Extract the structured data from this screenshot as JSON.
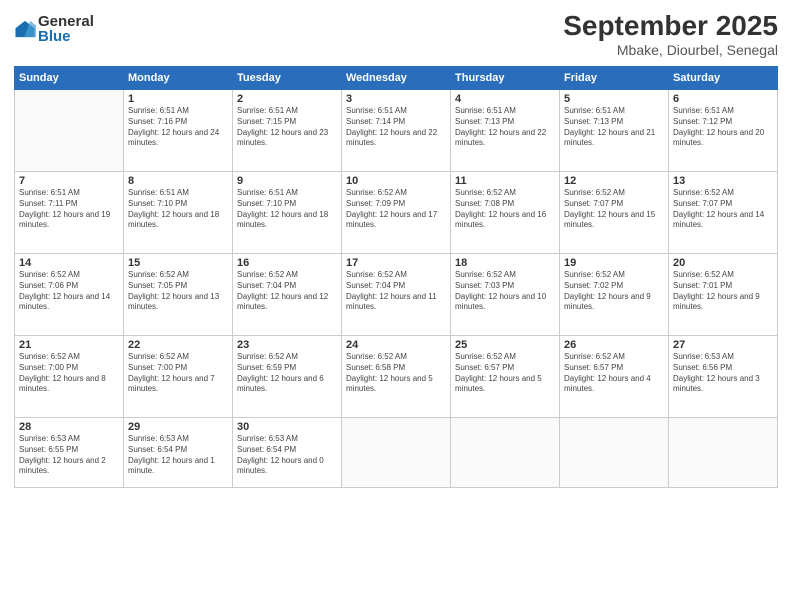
{
  "logo": {
    "general": "General",
    "blue": "Blue"
  },
  "header": {
    "title": "September 2025",
    "subtitle": "Mbake, Diourbel, Senegal"
  },
  "weekdays": [
    "Sunday",
    "Monday",
    "Tuesday",
    "Wednesday",
    "Thursday",
    "Friday",
    "Saturday"
  ],
  "weeks": [
    [
      {
        "day": null,
        "info": null
      },
      {
        "day": "1",
        "sunrise": "Sunrise: 6:51 AM",
        "sunset": "Sunset: 7:16 PM",
        "daylight": "Daylight: 12 hours and 24 minutes."
      },
      {
        "day": "2",
        "sunrise": "Sunrise: 6:51 AM",
        "sunset": "Sunset: 7:15 PM",
        "daylight": "Daylight: 12 hours and 23 minutes."
      },
      {
        "day": "3",
        "sunrise": "Sunrise: 6:51 AM",
        "sunset": "Sunset: 7:14 PM",
        "daylight": "Daylight: 12 hours and 22 minutes."
      },
      {
        "day": "4",
        "sunrise": "Sunrise: 6:51 AM",
        "sunset": "Sunset: 7:13 PM",
        "daylight": "Daylight: 12 hours and 22 minutes."
      },
      {
        "day": "5",
        "sunrise": "Sunrise: 6:51 AM",
        "sunset": "Sunset: 7:13 PM",
        "daylight": "Daylight: 12 hours and 21 minutes."
      },
      {
        "day": "6",
        "sunrise": "Sunrise: 6:51 AM",
        "sunset": "Sunset: 7:12 PM",
        "daylight": "Daylight: 12 hours and 20 minutes."
      }
    ],
    [
      {
        "day": "7",
        "sunrise": "Sunrise: 6:51 AM",
        "sunset": "Sunset: 7:11 PM",
        "daylight": "Daylight: 12 hours and 19 minutes."
      },
      {
        "day": "8",
        "sunrise": "Sunrise: 6:51 AM",
        "sunset": "Sunset: 7:10 PM",
        "daylight": "Daylight: 12 hours and 18 minutes."
      },
      {
        "day": "9",
        "sunrise": "Sunrise: 6:51 AM",
        "sunset": "Sunset: 7:10 PM",
        "daylight": "Daylight: 12 hours and 18 minutes."
      },
      {
        "day": "10",
        "sunrise": "Sunrise: 6:52 AM",
        "sunset": "Sunset: 7:09 PM",
        "daylight": "Daylight: 12 hours and 17 minutes."
      },
      {
        "day": "11",
        "sunrise": "Sunrise: 6:52 AM",
        "sunset": "Sunset: 7:08 PM",
        "daylight": "Daylight: 12 hours and 16 minutes."
      },
      {
        "day": "12",
        "sunrise": "Sunrise: 6:52 AM",
        "sunset": "Sunset: 7:07 PM",
        "daylight": "Daylight: 12 hours and 15 minutes."
      },
      {
        "day": "13",
        "sunrise": "Sunrise: 6:52 AM",
        "sunset": "Sunset: 7:07 PM",
        "daylight": "Daylight: 12 hours and 14 minutes."
      }
    ],
    [
      {
        "day": "14",
        "sunrise": "Sunrise: 6:52 AM",
        "sunset": "Sunset: 7:06 PM",
        "daylight": "Daylight: 12 hours and 14 minutes."
      },
      {
        "day": "15",
        "sunrise": "Sunrise: 6:52 AM",
        "sunset": "Sunset: 7:05 PM",
        "daylight": "Daylight: 12 hours and 13 minutes."
      },
      {
        "day": "16",
        "sunrise": "Sunrise: 6:52 AM",
        "sunset": "Sunset: 7:04 PM",
        "daylight": "Daylight: 12 hours and 12 minutes."
      },
      {
        "day": "17",
        "sunrise": "Sunrise: 6:52 AM",
        "sunset": "Sunset: 7:04 PM",
        "daylight": "Daylight: 12 hours and 11 minutes."
      },
      {
        "day": "18",
        "sunrise": "Sunrise: 6:52 AM",
        "sunset": "Sunset: 7:03 PM",
        "daylight": "Daylight: 12 hours and 10 minutes."
      },
      {
        "day": "19",
        "sunrise": "Sunrise: 6:52 AM",
        "sunset": "Sunset: 7:02 PM",
        "daylight": "Daylight: 12 hours and 9 minutes."
      },
      {
        "day": "20",
        "sunrise": "Sunrise: 6:52 AM",
        "sunset": "Sunset: 7:01 PM",
        "daylight": "Daylight: 12 hours and 9 minutes."
      }
    ],
    [
      {
        "day": "21",
        "sunrise": "Sunrise: 6:52 AM",
        "sunset": "Sunset: 7:00 PM",
        "daylight": "Daylight: 12 hours and 8 minutes."
      },
      {
        "day": "22",
        "sunrise": "Sunrise: 6:52 AM",
        "sunset": "Sunset: 7:00 PM",
        "daylight": "Daylight: 12 hours and 7 minutes."
      },
      {
        "day": "23",
        "sunrise": "Sunrise: 6:52 AM",
        "sunset": "Sunset: 6:59 PM",
        "daylight": "Daylight: 12 hours and 6 minutes."
      },
      {
        "day": "24",
        "sunrise": "Sunrise: 6:52 AM",
        "sunset": "Sunset: 6:58 PM",
        "daylight": "Daylight: 12 hours and 5 minutes."
      },
      {
        "day": "25",
        "sunrise": "Sunrise: 6:52 AM",
        "sunset": "Sunset: 6:57 PM",
        "daylight": "Daylight: 12 hours and 5 minutes."
      },
      {
        "day": "26",
        "sunrise": "Sunrise: 6:52 AM",
        "sunset": "Sunset: 6:57 PM",
        "daylight": "Daylight: 12 hours and 4 minutes."
      },
      {
        "day": "27",
        "sunrise": "Sunrise: 6:53 AM",
        "sunset": "Sunset: 6:56 PM",
        "daylight": "Daylight: 12 hours and 3 minutes."
      }
    ],
    [
      {
        "day": "28",
        "sunrise": "Sunrise: 6:53 AM",
        "sunset": "Sunset: 6:55 PM",
        "daylight": "Daylight: 12 hours and 2 minutes."
      },
      {
        "day": "29",
        "sunrise": "Sunrise: 6:53 AM",
        "sunset": "Sunset: 6:54 PM",
        "daylight": "Daylight: 12 hours and 1 minute."
      },
      {
        "day": "30",
        "sunrise": "Sunrise: 6:53 AM",
        "sunset": "Sunset: 6:54 PM",
        "daylight": "Daylight: 12 hours and 0 minutes."
      },
      {
        "day": null,
        "info": null
      },
      {
        "day": null,
        "info": null
      },
      {
        "day": null,
        "info": null
      },
      {
        "day": null,
        "info": null
      }
    ]
  ]
}
